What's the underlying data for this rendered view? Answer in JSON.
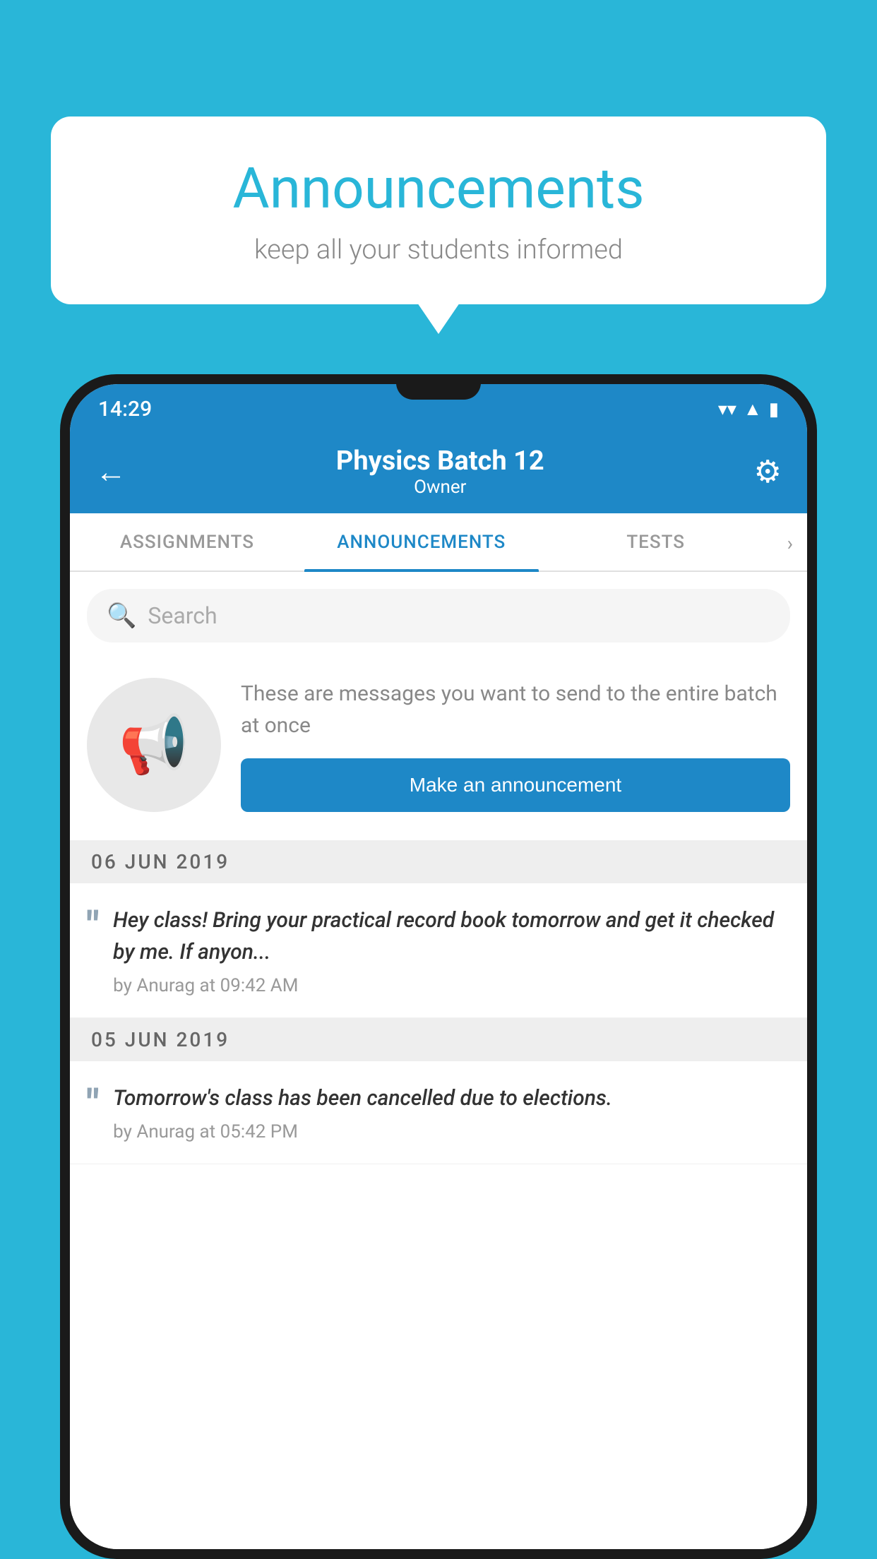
{
  "background_color": "#29B6D8",
  "speech_bubble": {
    "title": "Announcements",
    "subtitle": "keep all your students informed"
  },
  "status_bar": {
    "time": "14:29",
    "wifi": "▼",
    "signal": "▲",
    "battery": "▮"
  },
  "app_bar": {
    "title": "Physics Batch 12",
    "subtitle": "Owner",
    "back_label": "←",
    "settings_label": "⚙"
  },
  "tabs": [
    {
      "label": "ASSIGNMENTS",
      "active": false
    },
    {
      "label": "ANNOUNCEMENTS",
      "active": true
    },
    {
      "label": "TESTS",
      "active": false
    }
  ],
  "search": {
    "placeholder": "Search"
  },
  "empty_state": {
    "description": "These are messages you want to send to the entire batch at once",
    "button_label": "Make an announcement"
  },
  "date_groups": [
    {
      "date": "06  JUN  2019",
      "announcements": [
        {
          "message": "Hey class! Bring your practical record book tomorrow and get it checked by me. If anyon...",
          "meta": "by Anurag at 09:42 AM"
        }
      ]
    },
    {
      "date": "05  JUN  2019",
      "announcements": [
        {
          "message": "Tomorrow's class has been cancelled due to elections.",
          "meta": "by Anurag at 05:42 PM"
        }
      ]
    }
  ]
}
